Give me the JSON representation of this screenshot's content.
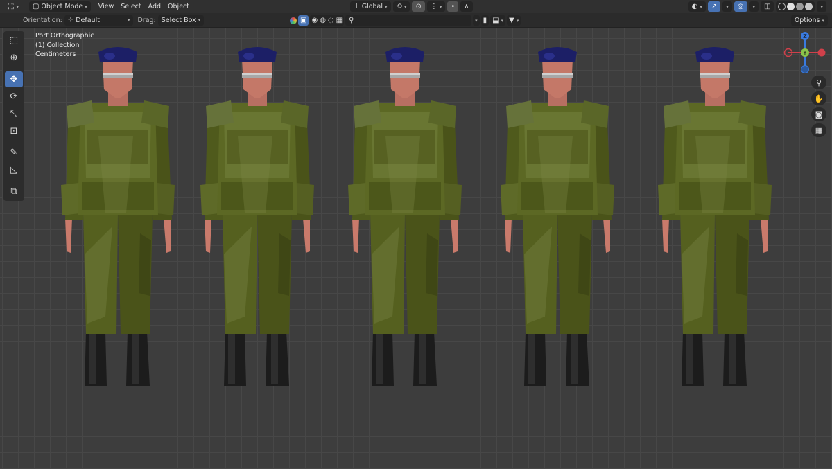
{
  "header": {
    "mode": "Object Mode",
    "menus": [
      "View",
      "Select",
      "Add",
      "Object"
    ],
    "transform_orientation": "Global",
    "colors": {
      "bg": "#303030",
      "accent": "#4772b3"
    }
  },
  "tool_settings": {
    "orientation_label": "Orientation:",
    "orientation_value": "Default",
    "drag_label": "Drag:",
    "drag_value": "Select Box",
    "search_placeholder": "",
    "options_label": "Options"
  },
  "viewport": {
    "view_name": "Port Orthographic",
    "collection": "(1) Collection",
    "units": "Centimeters",
    "gizmo": {
      "z": "Z",
      "y": "Y",
      "x_color": "#d0404a",
      "y_color": "#8bc34a",
      "z_color": "#3a7be0"
    },
    "soldier_count": 5
  },
  "toolbar": {
    "tools": [
      "select-box",
      "cursor",
      "move",
      "rotate",
      "scale",
      "transform",
      "annotate",
      "measure",
      "add-cube"
    ],
    "active": "move"
  }
}
